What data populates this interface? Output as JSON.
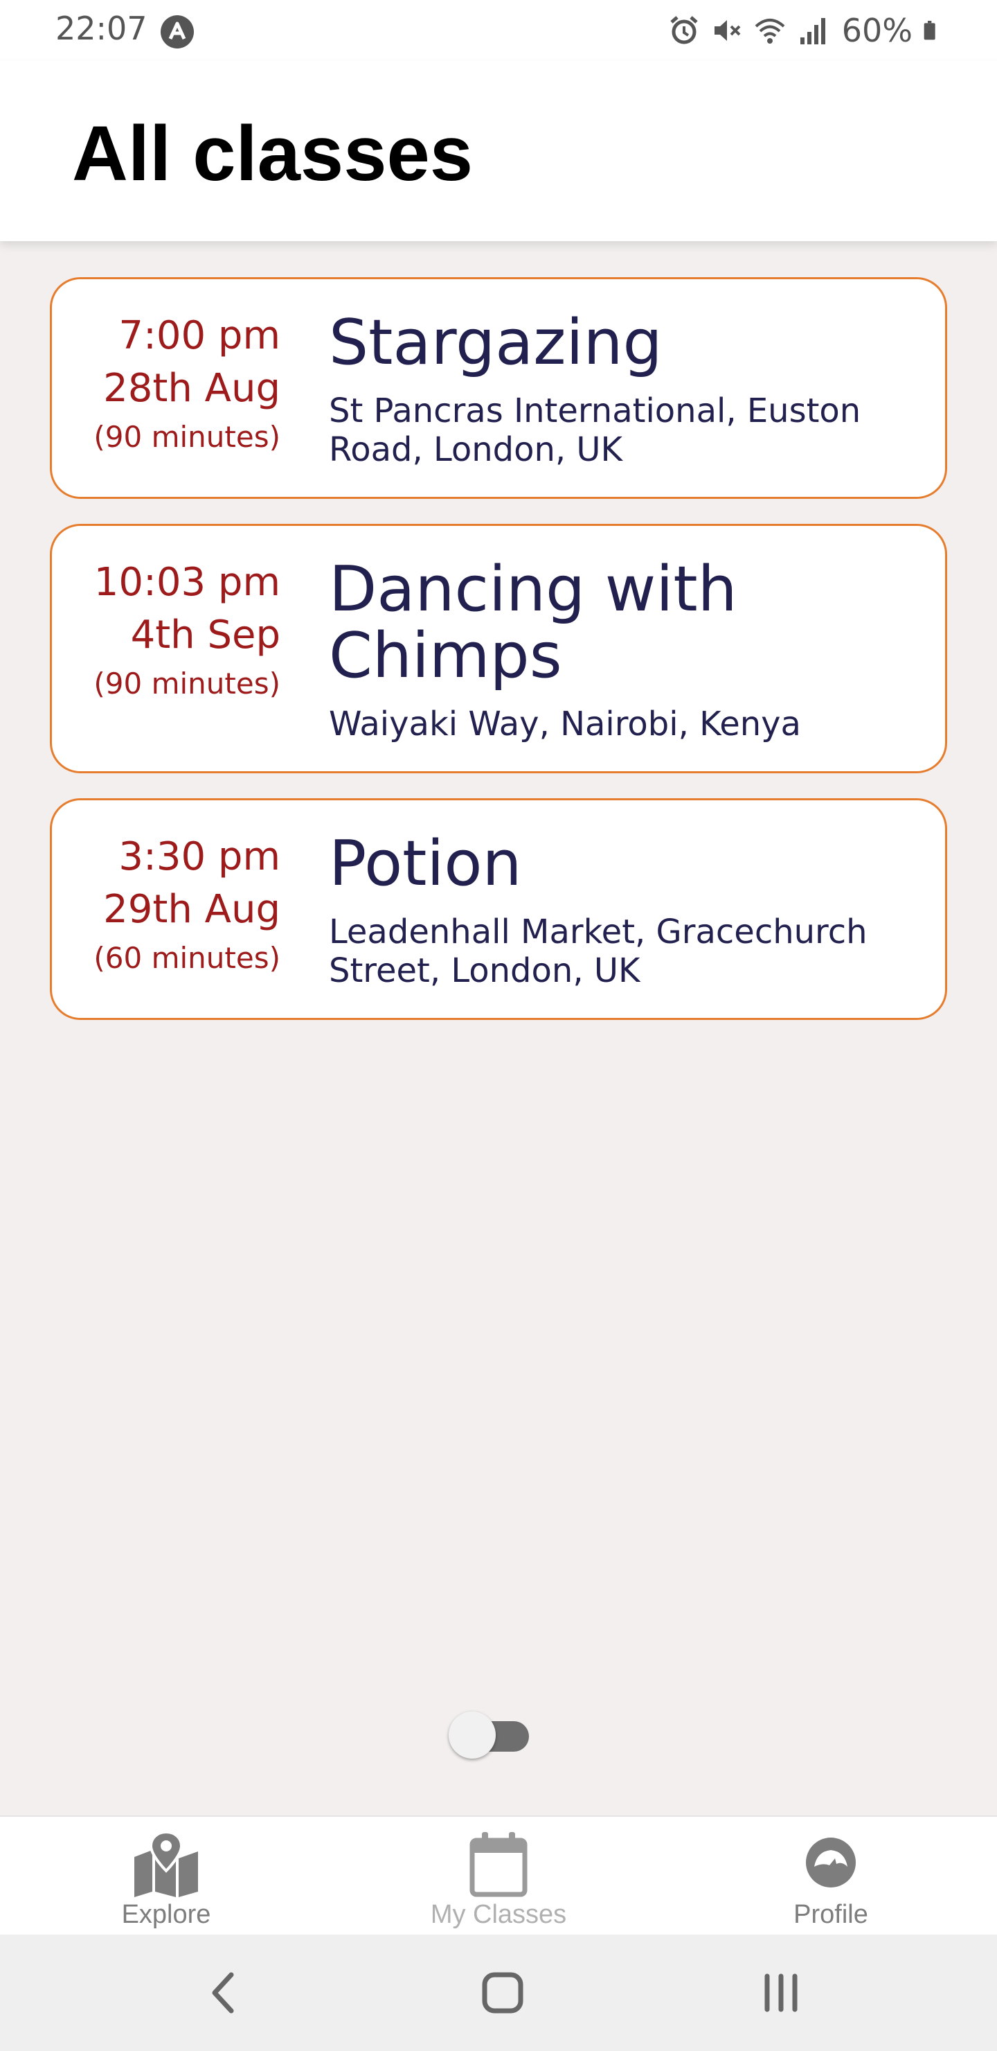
{
  "status_bar": {
    "time": "22:07",
    "battery_percent": "60%",
    "icons": [
      "app-notification-icon",
      "alarm-icon",
      "mute-icon",
      "wifi-icon",
      "signal-icon",
      "battery-icon"
    ]
  },
  "header": {
    "title": "All classes"
  },
  "classes": [
    {
      "time": "7:00 pm",
      "date": "28th Aug",
      "duration": "(90 minutes)",
      "title": "Stargazing",
      "location": "St Pancras International, Euston Road, London, UK"
    },
    {
      "time": "10:03 pm",
      "date": "4th Sep",
      "duration": "(90 minutes)",
      "title": "Dancing with Chimps",
      "location": "Waiyaki Way, Nairobi, Kenya"
    },
    {
      "time": "3:30 pm",
      "date": "29th Aug",
      "duration": "(60 minutes)",
      "title": "Potion",
      "location": "Leadenhall Market, Gracechurch Street, London, UK"
    }
  ],
  "toggle": {
    "on": false
  },
  "tabs": [
    {
      "label": "Explore",
      "icon": "map-icon",
      "active": false
    },
    {
      "label": "My Classes",
      "icon": "calendar-icon",
      "active": true
    },
    {
      "label": "Profile",
      "icon": "profile-icon",
      "active": false
    }
  ],
  "system_nav": {
    "buttons": [
      "back-icon",
      "home-icon",
      "recent-apps-icon"
    ]
  },
  "colors": {
    "card_border": "#e67d2e",
    "when_text": "#9e1b1b",
    "info_text": "#22204e",
    "background": "#f2efee"
  }
}
